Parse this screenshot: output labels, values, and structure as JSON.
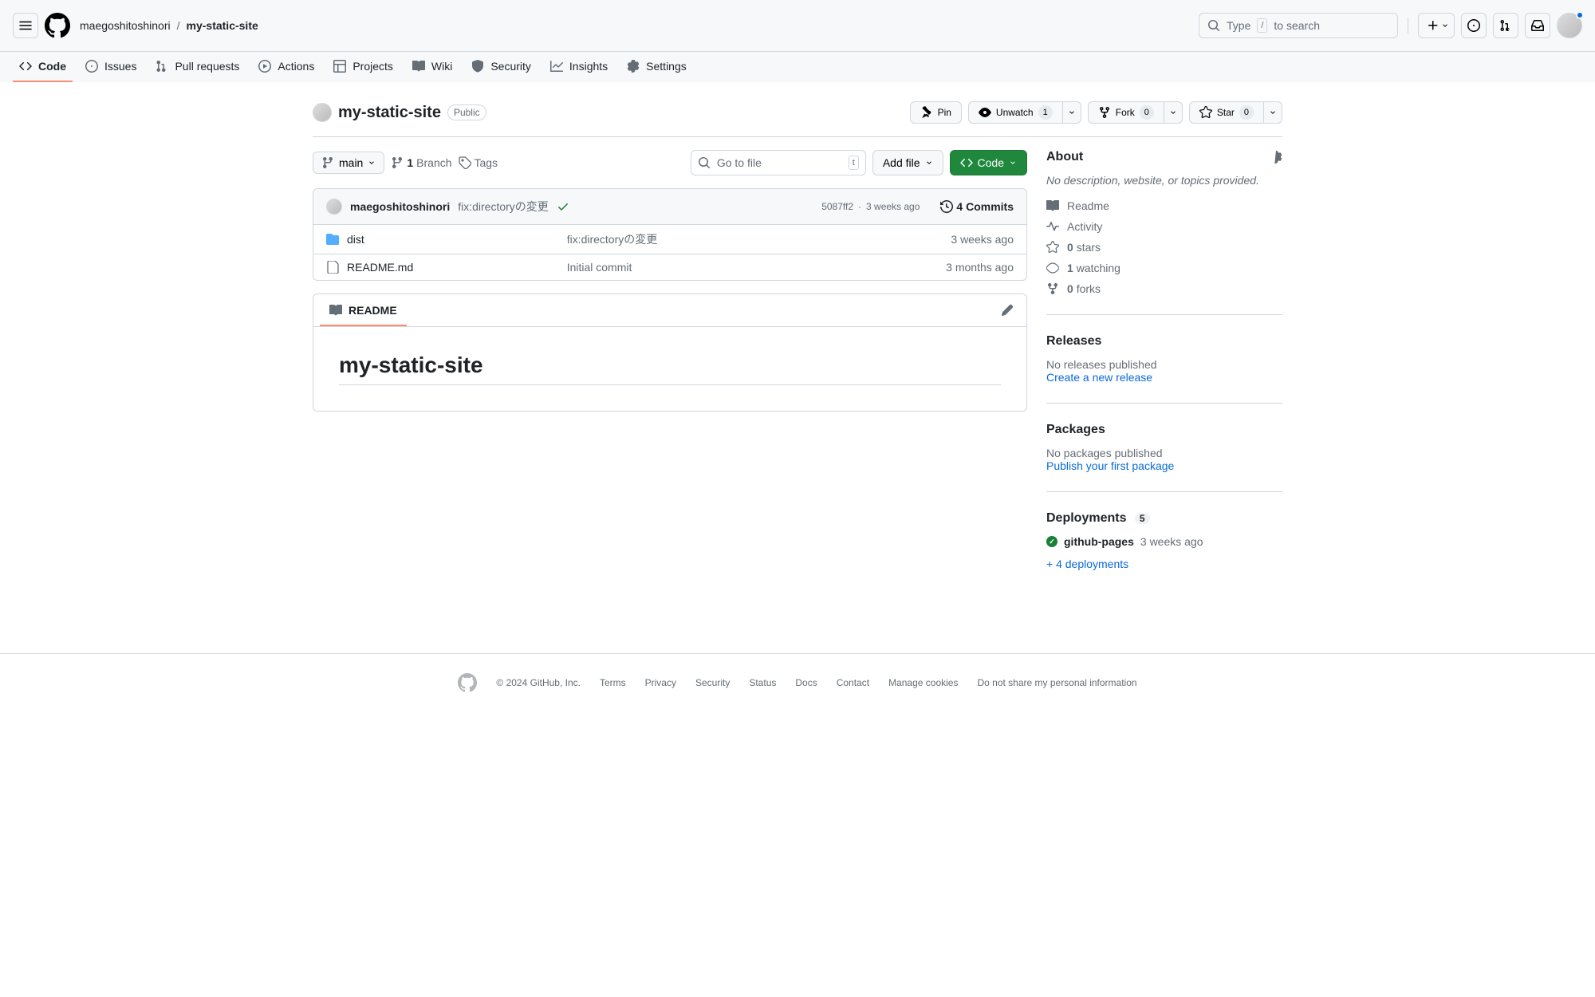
{
  "header": {
    "owner": "maegoshitoshinori",
    "repo": "my-static-site",
    "search_prompt_prefix": "Type",
    "search_prompt_key": "/",
    "search_prompt_suffix": "to search"
  },
  "nav": {
    "code": "Code",
    "issues": "Issues",
    "pulls": "Pull requests",
    "actions": "Actions",
    "projects": "Projects",
    "wiki": "Wiki",
    "security": "Security",
    "insights": "Insights",
    "settings": "Settings"
  },
  "repo": {
    "name": "my-static-site",
    "visibility": "Public",
    "pin": "Pin",
    "unwatch": "Unwatch",
    "watch_count": "1",
    "fork": "Fork",
    "fork_count": "0",
    "star": "Star",
    "star_count": "0"
  },
  "toolbar": {
    "branch": "main",
    "branches_count": "1",
    "branches_label": "Branch",
    "tags_label": "Tags",
    "gotofile_placeholder": "Go to file",
    "gotofile_key": "t",
    "addfile": "Add file",
    "code_btn": "Code"
  },
  "commits": {
    "author": "maegoshitoshinori",
    "message": "fix:directoryの変更",
    "sha": "5087ff2",
    "time": "3 weeks ago",
    "count_label": "4 Commits"
  },
  "files": [
    {
      "type": "dir",
      "name": "dist",
      "msg": "fix:directoryの変更",
      "date": "3 weeks ago"
    },
    {
      "type": "file",
      "name": "README.md",
      "msg": "Initial commit",
      "date": "3 months ago"
    }
  ],
  "readme": {
    "tab": "README",
    "heading": "my-static-site"
  },
  "about": {
    "header": "About",
    "desc": "No description, website, or topics provided.",
    "readme": "Readme",
    "activity": "Activity",
    "stars_count": "0",
    "stars_label": "stars",
    "watching_count": "1",
    "watching_label": "watching",
    "forks_count": "0",
    "forks_label": "forks"
  },
  "releases": {
    "header": "Releases",
    "none": "No releases published",
    "create": "Create a new release"
  },
  "packages": {
    "header": "Packages",
    "none": "No packages published",
    "publish": "Publish your first package"
  },
  "deployments": {
    "header": "Deployments",
    "count": "5",
    "env": "github-pages",
    "time": "3 weeks ago",
    "more": "+ 4 deployments"
  },
  "footer": {
    "copyright": "© 2024 GitHub, Inc.",
    "links": [
      "Terms",
      "Privacy",
      "Security",
      "Status",
      "Docs",
      "Contact",
      "Manage cookies",
      "Do not share my personal information"
    ]
  }
}
